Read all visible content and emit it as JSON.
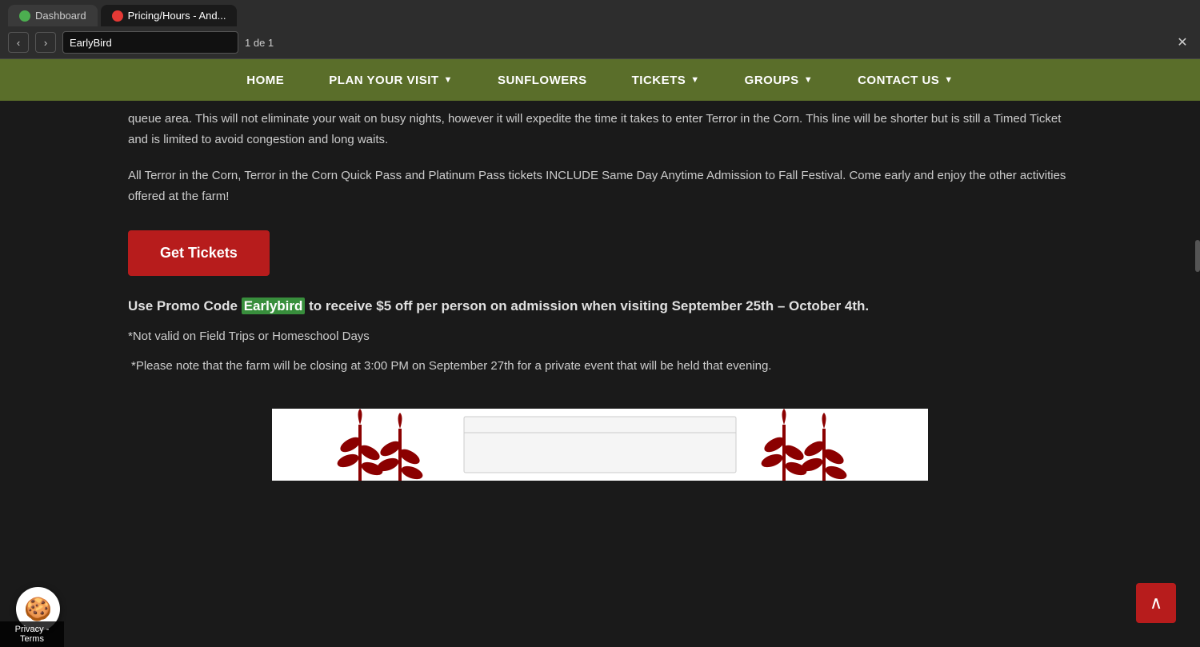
{
  "browser": {
    "tabs": [
      {
        "id": "tab-dashboard",
        "label": "Dashboard",
        "favicon": "green",
        "active": false
      },
      {
        "id": "tab-pricing",
        "label": "Pricing/Hours - And...",
        "favicon": "red",
        "active": true
      }
    ],
    "search_input": "EarlyBird",
    "search_placeholder": "EarlyBird",
    "page_count": "1 de 1",
    "nav_prev": "‹",
    "nav_next": "›",
    "close_btn": "✕"
  },
  "nav": {
    "items": [
      {
        "id": "home",
        "label": "HOME",
        "has_dropdown": false
      },
      {
        "id": "plan-your-visit",
        "label": "PLAN YOUR VISIT",
        "has_dropdown": true
      },
      {
        "id": "sunflowers",
        "label": "SUNFLOWERS",
        "has_dropdown": false
      },
      {
        "id": "tickets",
        "label": "TICKETS",
        "has_dropdown": true
      },
      {
        "id": "groups",
        "label": "GROUPS",
        "has_dropdown": true
      },
      {
        "id": "contact-us",
        "label": "CONTACT US",
        "has_dropdown": true
      }
    ]
  },
  "content": {
    "paragraph1": "queue area. This will not eliminate your wait on busy nights, however it will expedite the time it takes to enter Terror in the Corn. This line will be shorter but is still a Timed Ticket and is limited to avoid congestion and long waits.",
    "paragraph2": "All Terror in the Corn, Terror in the Corn Quick Pass and Platinum Pass tickets INCLUDE Same Day Anytime Admission to Fall Festival. Come early and enjoy the other activities offered at the farm!",
    "get_tickets_label": "Get Tickets",
    "promo_text_before": "Use Promo Code ",
    "promo_code": "Earlybird",
    "promo_text_after": " to receive $5 off per person on admission when visiting September 25th – October 4th.",
    "note1": "*Not valid on Field Trips or Homeschool Days",
    "note2": "*Please note that the farm will be closing at 3:00 PM on September 27th for a private event that will be held that evening."
  },
  "ui": {
    "back_to_top": "∧",
    "cookie_icon": "🍪",
    "cookie_label": "Privacy - Terms",
    "colors": {
      "nav_bg": "#5a6e2a",
      "btn_red": "#b71c1c",
      "promo_green": "#388e3c",
      "back_to_top_red": "#b71c1c",
      "body_bg": "#1a1a1a"
    }
  }
}
